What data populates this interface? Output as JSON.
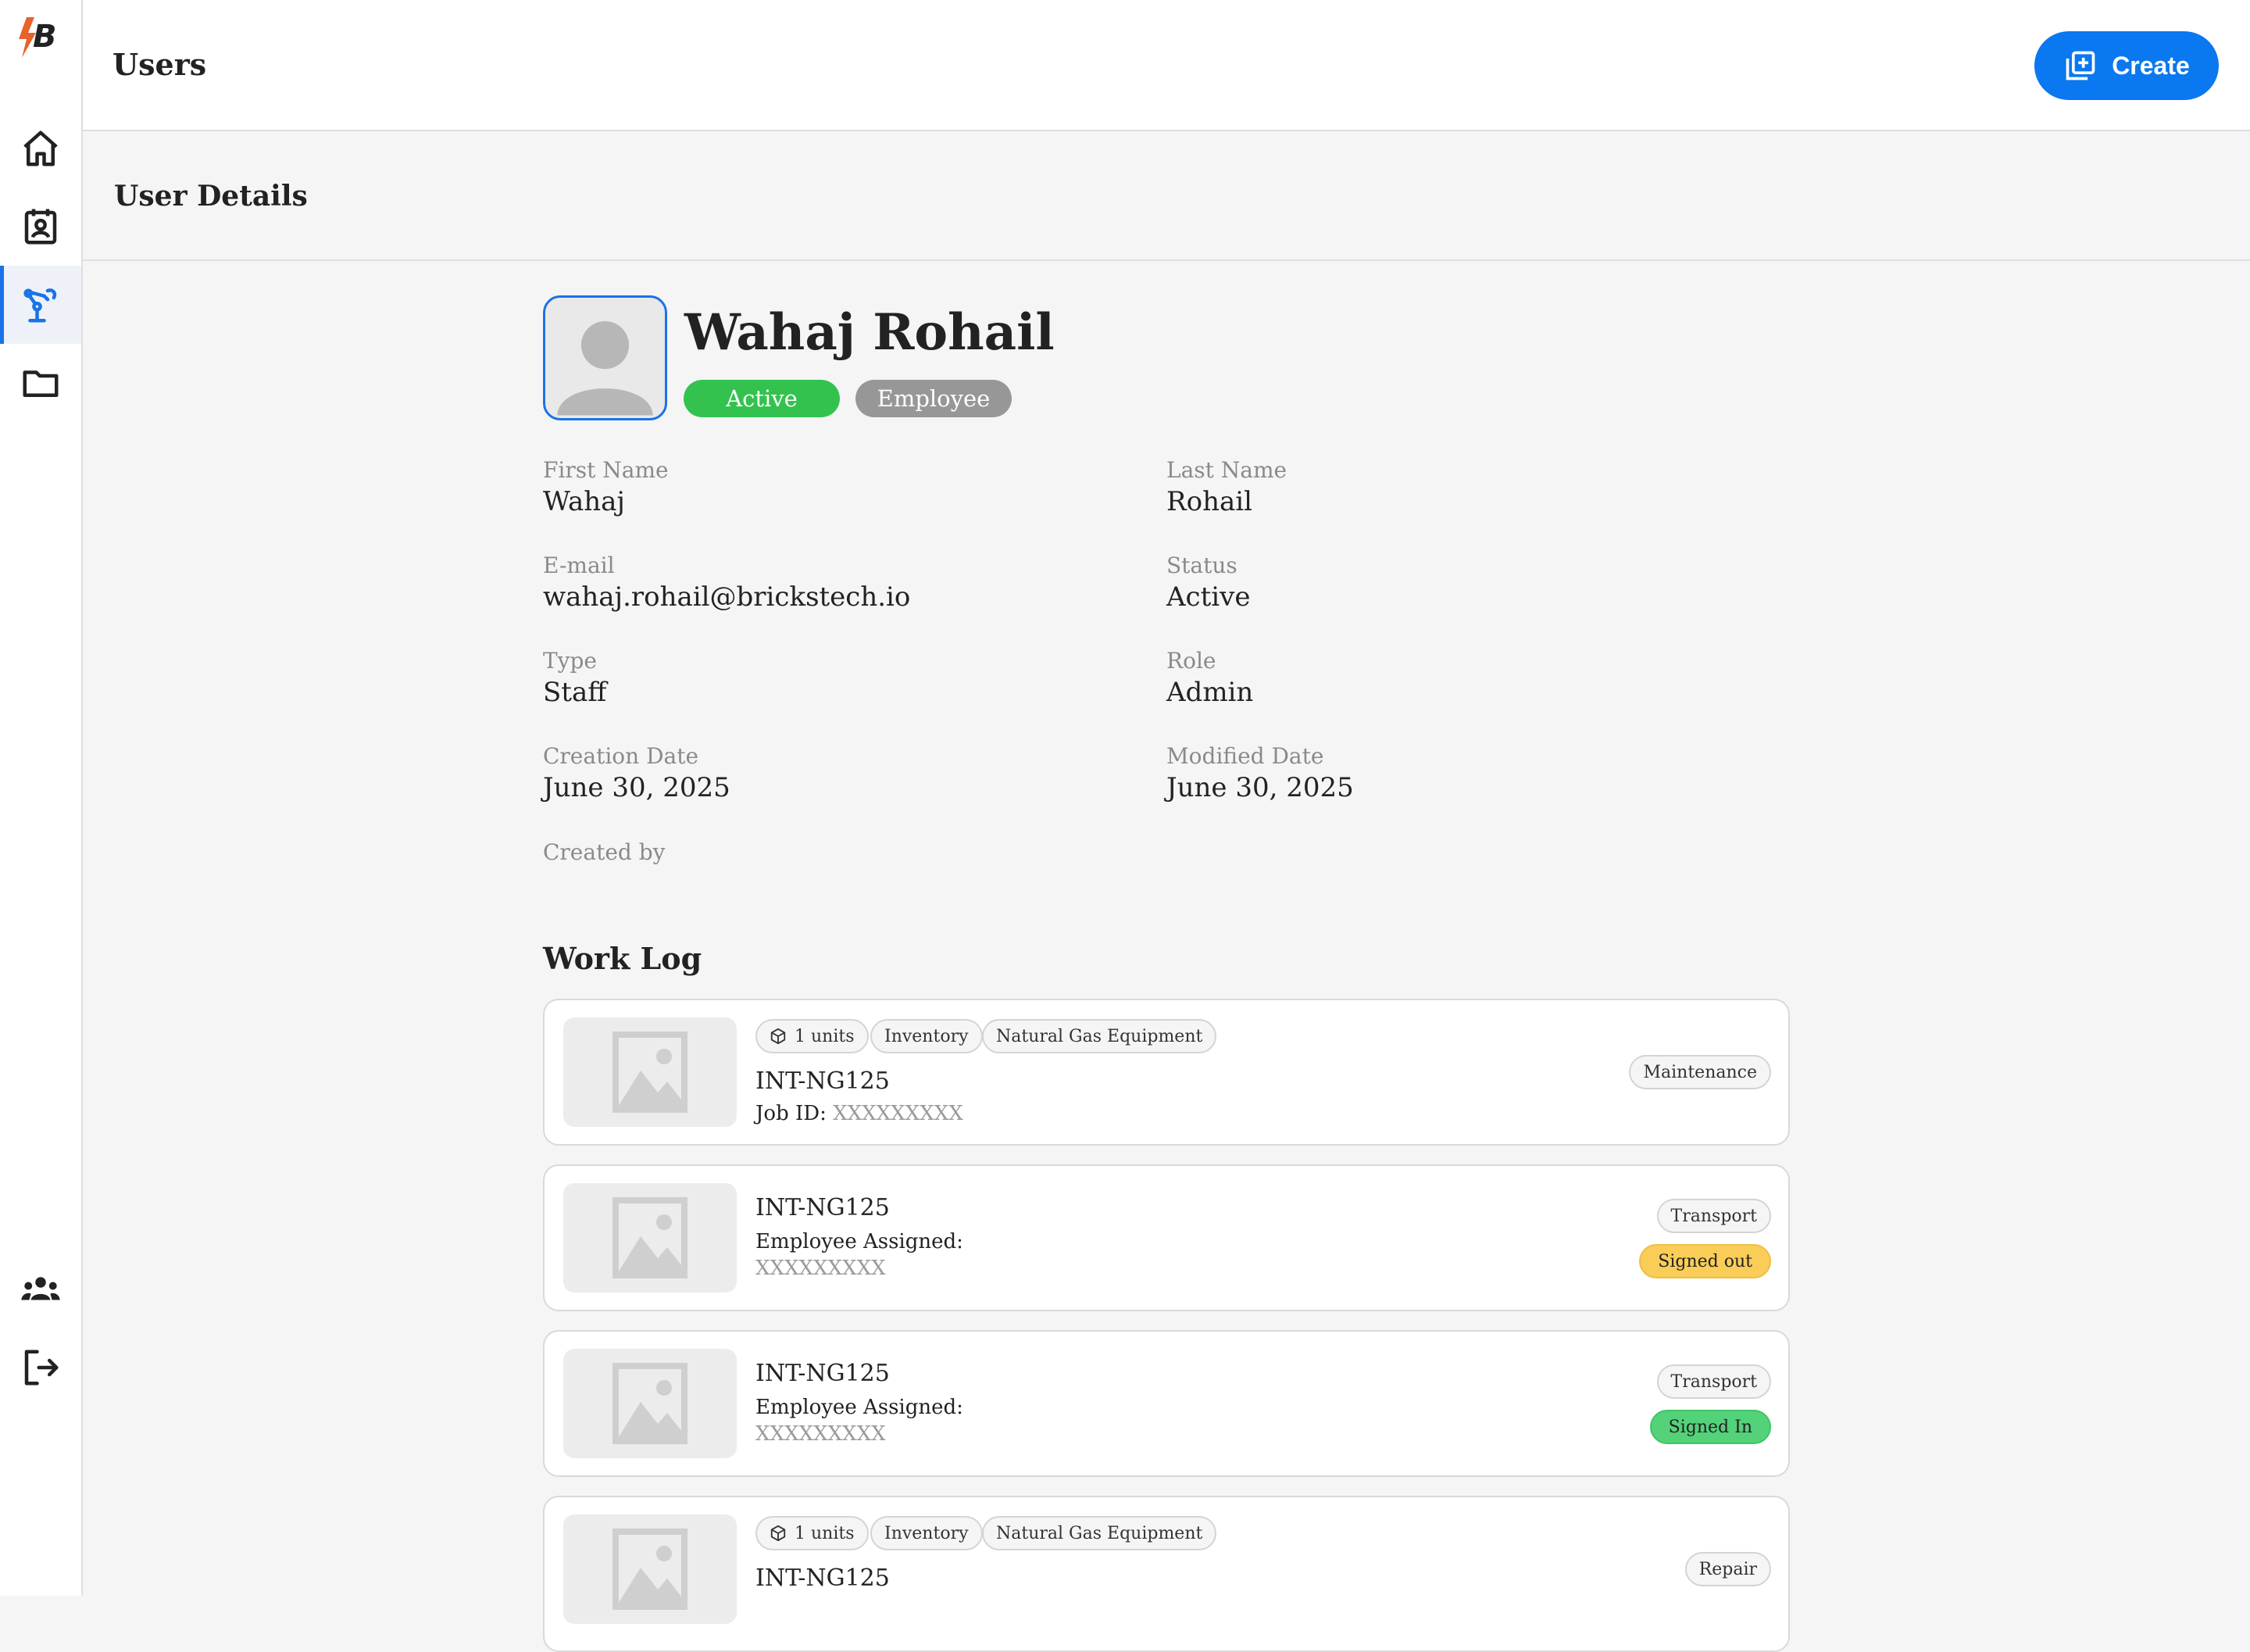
{
  "header": {
    "title": "Users",
    "create_label": "Create"
  },
  "section": {
    "title": "User Details"
  },
  "sidebar": {
    "items": [
      {
        "name": "home",
        "icon": "home-icon"
      },
      {
        "name": "contacts",
        "icon": "contact-card-icon"
      },
      {
        "name": "equipment",
        "icon": "robot-arm-icon",
        "active": true
      },
      {
        "name": "files",
        "icon": "folder-icon"
      }
    ],
    "bottom": [
      {
        "name": "team",
        "icon": "group-icon"
      },
      {
        "name": "logout",
        "icon": "logout-icon"
      }
    ]
  },
  "user": {
    "name": "Wahaj Rohail",
    "status_badge": "Active",
    "type_badge": "Employee",
    "fields": {
      "first_name": {
        "label": "First Name",
        "value": "Wahaj"
      },
      "last_name": {
        "label": "Last Name",
        "value": "Rohail"
      },
      "email": {
        "label": "E-mail",
        "value": "wahaj.rohail@brickstech.io"
      },
      "status": {
        "label": "Status",
        "value": "Active"
      },
      "type": {
        "label": "Type",
        "value": "Staff"
      },
      "role": {
        "label": "Role",
        "value": "Admin"
      },
      "creation_date": {
        "label": "Creation Date",
        "value": "June 30, 2025"
      },
      "modified_date": {
        "label": "Modified Date",
        "value": "June 30, 2025"
      },
      "created_by": {
        "label": "Created by",
        "value": ""
      }
    }
  },
  "worklog": {
    "title": "Work Log",
    "items": [
      {
        "chips": [
          "1 units",
          "Inventory",
          "Natural Gas Equipment"
        ],
        "code": "INT-NG125",
        "job_label": "Job ID: ",
        "job_id": "XXXXXXXXX",
        "category": "Maintenance"
      },
      {
        "code": "INT-NG125",
        "assigned_label": "Employee Assigned:",
        "assigned_value": "XXXXXXXXX",
        "category": "Transport",
        "status": "Signed out"
      },
      {
        "code": "INT-NG125",
        "assigned_label": "Employee Assigned:",
        "assigned_value": "XXXXXXXXX",
        "category": "Transport",
        "status": "Signed In"
      },
      {
        "chips": [
          "1 units",
          "Inventory",
          "Natural Gas Equipment"
        ],
        "code": "INT-NG125",
        "category": "Repair"
      }
    ]
  },
  "colors": {
    "accent": "#0a78f0",
    "active": "#34c24f",
    "employee": "#979797",
    "signed_out": "#f9cd58",
    "signed_in": "#54d27a"
  }
}
